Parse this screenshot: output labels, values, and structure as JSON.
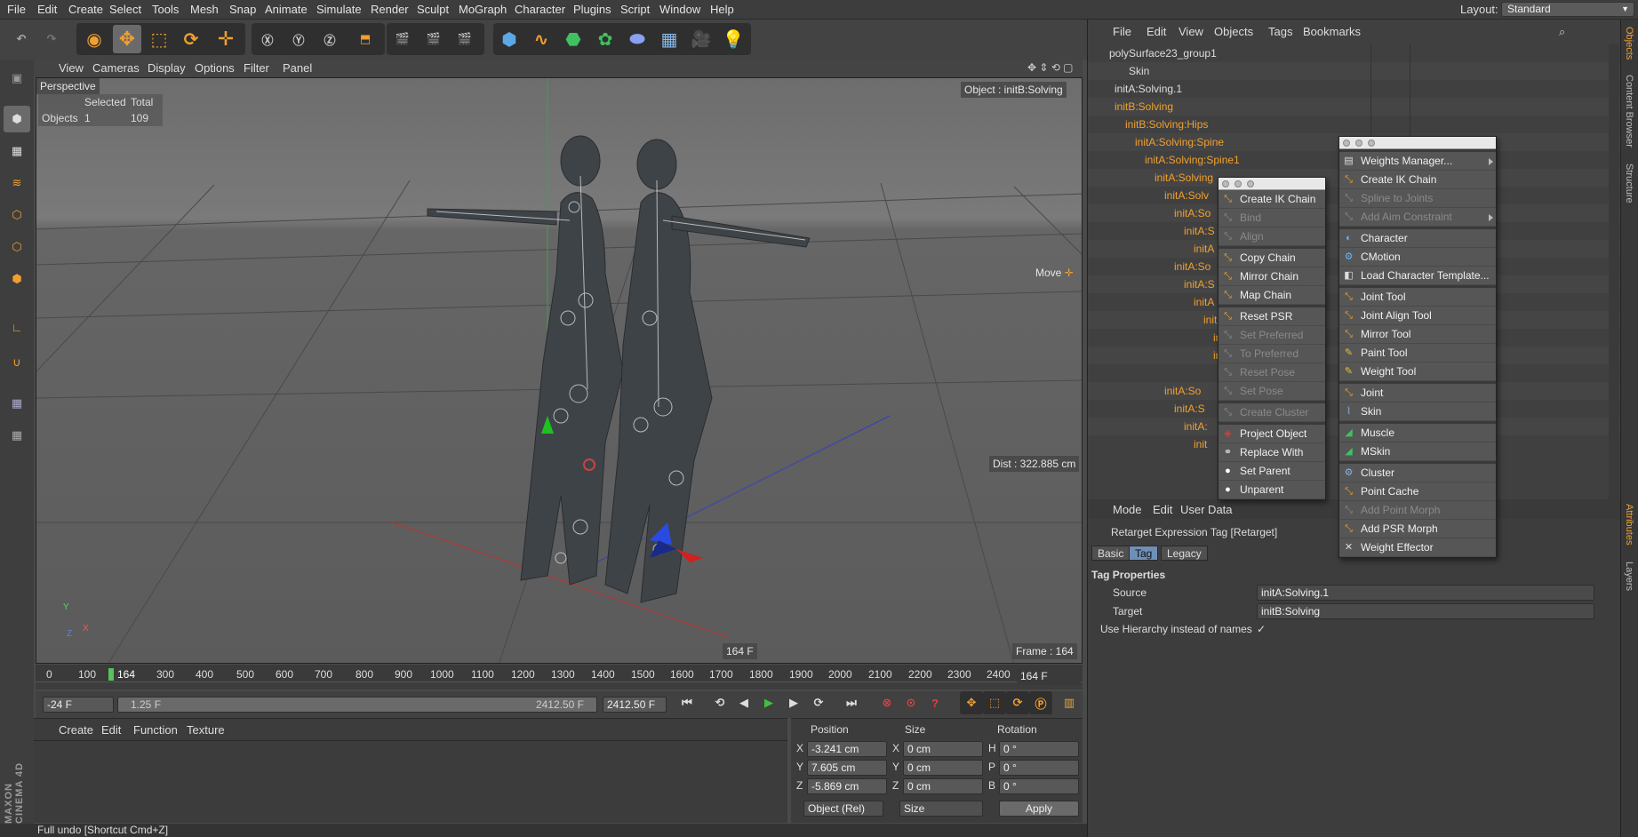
{
  "menubar": {
    "items": [
      "File",
      "Edit",
      "Create",
      "Select",
      "Tools",
      "Mesh",
      "Snap",
      "Animate",
      "Simulate",
      "Render",
      "Sculpt",
      "MoGraph",
      "Character",
      "Plugins",
      "Script",
      "Window",
      "Help"
    ],
    "layout_label": "Layout:",
    "layout_value": "Standard"
  },
  "viewport_menu": [
    "View",
    "Cameras",
    "Display",
    "Options",
    "Filter",
    "Panel"
  ],
  "viewport": {
    "camera_label": "Perspective",
    "stats_headers": [
      "Selected",
      "Total"
    ],
    "stats_row_label": "Objects",
    "stats_selected": "1",
    "stats_total": "109",
    "object_label": "Object : initB:Solving",
    "move_label": "Move",
    "dist_label": "Dist : 322.885 cm",
    "frame_label": "Frame : 164",
    "frame_marker": "164 F",
    "axis_y": "Y",
    "axis_x": "X",
    "axis_z": "Z"
  },
  "timeline": {
    "ticks": [
      "0",
      "100",
      "164",
      "300",
      "400",
      "500",
      "600",
      "700",
      "800",
      "900",
      "1000",
      "1100",
      "1200",
      "1300",
      "1400",
      "1500",
      "1600",
      "1700",
      "1800",
      "1900",
      "2000",
      "2100",
      "2200",
      "2300",
      "2400"
    ],
    "current_frame": "164 F"
  },
  "transport": {
    "start": "-24 F",
    "range_left": "1.25 F",
    "range_right": "2412.50 F",
    "end": "2412.50 F"
  },
  "material_menu": [
    "Create",
    "Edit",
    "Function",
    "Texture"
  ],
  "coords": {
    "headers": [
      "Position",
      "Size",
      "Rotation"
    ],
    "rows": [
      {
        "pos_axis": "X",
        "pos": "-3.241 cm",
        "size_axis": "X",
        "size": "0 cm",
        "rot_axis": "H",
        "rot": "0 °"
      },
      {
        "pos_axis": "Y",
        "pos": "7.605 cm",
        "size_axis": "Y",
        "size": "0 cm",
        "rot_axis": "P",
        "rot": "0 °"
      },
      {
        "pos_axis": "Z",
        "pos": "-5.869 cm",
        "size_axis": "Z",
        "size": "0 cm",
        "rot_axis": "B",
        "rot": "0 °"
      }
    ],
    "mode": "Object (Rel)",
    "size_mode": "Size",
    "apply": "Apply"
  },
  "status": "Full undo [Shortcut Cmd+Z]",
  "logo": "MAXON CINEMA 4D",
  "objects_menu": [
    "File",
    "Edit",
    "View",
    "Objects",
    "Tags",
    "Bookmarks"
  ],
  "objects": [
    "polySurface23_group1",
    "Skin",
    "initA:Solving.1",
    "initB:Solving",
    "initB:Solving:Hips",
    "initA:Solving:Spine",
    "initA:Solving:Spine1",
    "initA:Solving",
    "initA:Solv",
    "initA:So",
    "initA:S",
    "initA",
    "initA:So",
    "initA:S",
    "initA",
    "init",
    "init",
    "init",
    "init",
    "initA:So",
    "initA:S",
    "initA:",
    "init"
  ],
  "attr_menu": [
    "Mode",
    "Edit",
    "User Data"
  ],
  "attr": {
    "title": "Retarget Expression Tag [Retarget]",
    "tabs": [
      "Basic",
      "Tag",
      "Legacy"
    ],
    "section": "Tag Properties",
    "source_label": "Source",
    "source_value": "initA:Solving.1",
    "target_label": "Target",
    "target_value": "initB:Solving",
    "hierarchy_label": "Use Hierarchy instead of names",
    "hierarchy_check": "✓"
  },
  "right_strip": [
    "Objects",
    "Content Browser",
    "Structure",
    "Attributes",
    "Layers"
  ],
  "popup1": [
    {
      "label": "Create IK Chain",
      "enabled": true
    },
    {
      "label": "Bind",
      "enabled": false
    },
    {
      "label": "Align",
      "enabled": false
    },
    {
      "label": "Copy Chain",
      "enabled": true
    },
    {
      "label": "Mirror Chain",
      "enabled": true
    },
    {
      "label": "Map Chain",
      "enabled": true
    },
    {
      "label": "Reset PSR",
      "enabled": true
    },
    {
      "label": "Set Preferred",
      "enabled": false
    },
    {
      "label": "To Preferred",
      "enabled": false
    },
    {
      "label": "Reset Pose",
      "enabled": false
    },
    {
      "label": "Set Pose",
      "enabled": false
    },
    {
      "label": "Create Cluster",
      "enabled": false
    },
    {
      "label": "Project Object",
      "enabled": true
    },
    {
      "label": "Replace With",
      "enabled": true
    },
    {
      "label": "Set Parent",
      "enabled": true
    },
    {
      "label": "Unparent",
      "enabled": true
    }
  ],
  "popup2": [
    {
      "label": "Weights Manager...",
      "enabled": true
    },
    {
      "label": "Create IK Chain",
      "enabled": true
    },
    {
      "label": "Spline to Joints",
      "enabled": false
    },
    {
      "label": "Add Aim Constraint",
      "enabled": false
    },
    {
      "label": "Character",
      "enabled": true
    },
    {
      "label": "CMotion",
      "enabled": true
    },
    {
      "label": "Load Character Template...",
      "enabled": true
    },
    {
      "label": "Joint Tool",
      "enabled": true
    },
    {
      "label": "Joint Align Tool",
      "enabled": true
    },
    {
      "label": "Mirror Tool",
      "enabled": true
    },
    {
      "label": "Paint Tool",
      "enabled": true
    },
    {
      "label": "Weight Tool",
      "enabled": true
    },
    {
      "label": "Joint",
      "enabled": true
    },
    {
      "label": "Skin",
      "enabled": true
    },
    {
      "label": "Muscle",
      "enabled": true
    },
    {
      "label": "MSkin",
      "enabled": true
    },
    {
      "label": "Cluster",
      "enabled": true
    },
    {
      "label": "Point Cache",
      "enabled": true
    },
    {
      "label": "Add Point Morph",
      "enabled": false
    },
    {
      "label": "Add PSR Morph",
      "enabled": true
    },
    {
      "label": "Weight Effector",
      "enabled": true
    }
  ],
  "colors": {
    "accent_orange": "#f0a030",
    "selected_blue": "#6f8fb7",
    "panel_bg": "#404040"
  }
}
